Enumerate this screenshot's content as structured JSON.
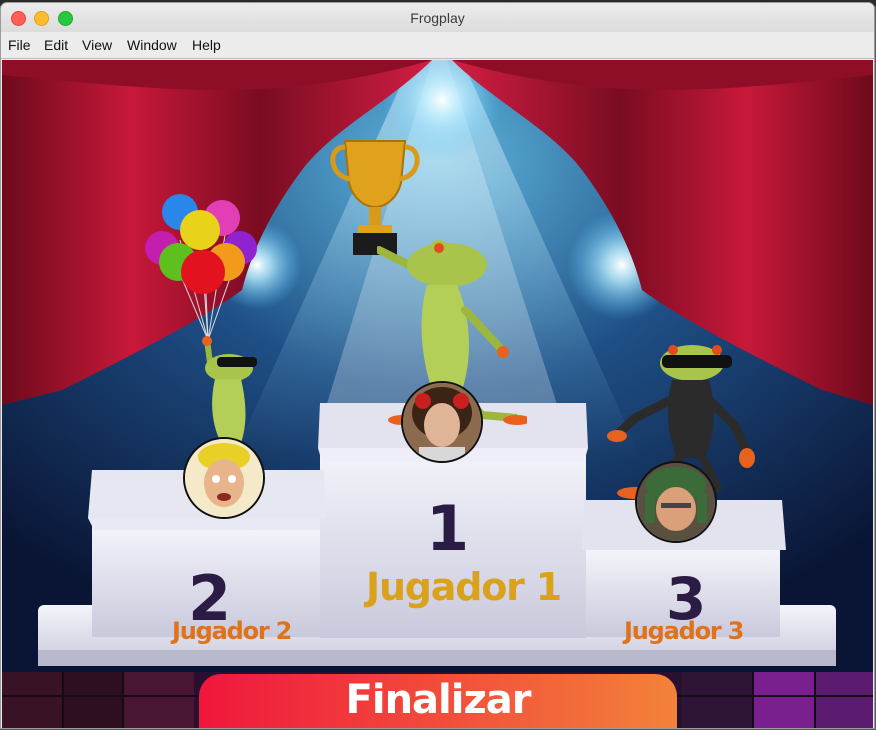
{
  "window": {
    "title": "Frogplay"
  },
  "menu": [
    "File",
    "Edit",
    "View",
    "Window",
    "Help"
  ],
  "podium": {
    "first": {
      "rank": "1",
      "player": "Jugador 1"
    },
    "second": {
      "rank": "2",
      "player": "Jugador 2"
    },
    "third": {
      "rank": "3",
      "player": "Jugador 3"
    }
  },
  "actions": {
    "finish_label": "Finalizar"
  },
  "colors": {
    "curtain": "#b0122f",
    "spotlight": "#4fb9e8",
    "gold_label": "#d9a21a",
    "orange_label": "#e0731a",
    "button_start": "#f0163c",
    "button_end": "#f3823a"
  },
  "icons": [
    "trophy-icon",
    "balloons-icon",
    "frog-icon"
  ]
}
